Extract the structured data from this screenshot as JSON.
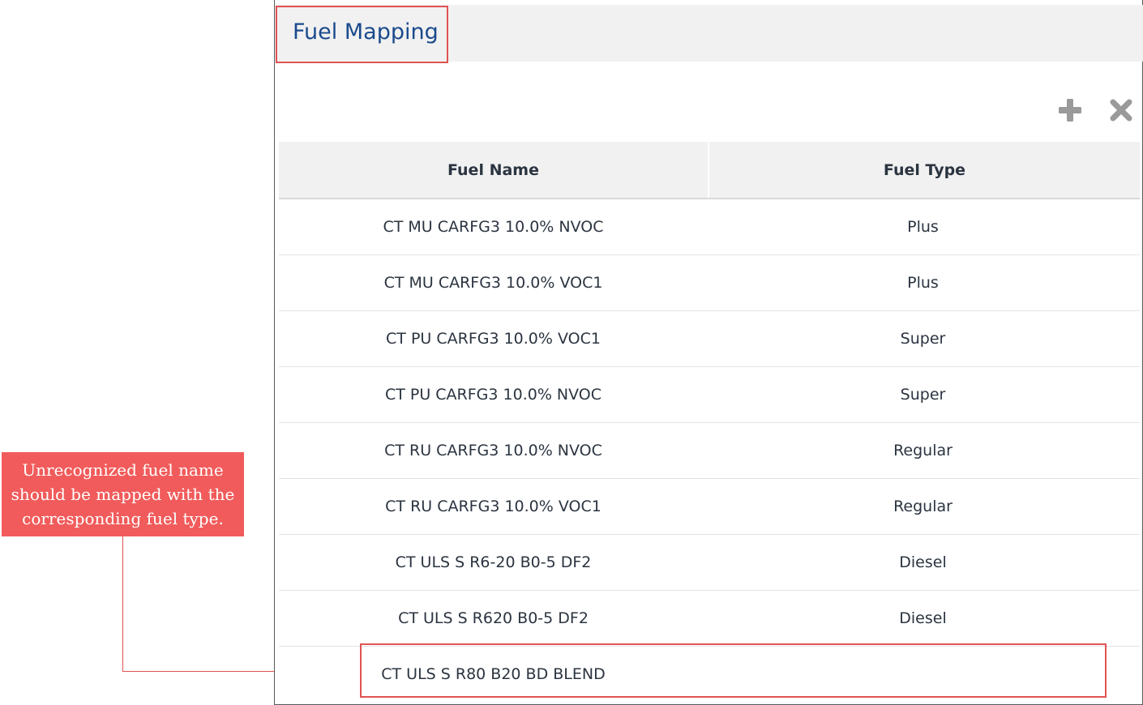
{
  "callout": {
    "lines": [
      "Unrecognized fuel name",
      "should be mapped with the",
      "corresponding fuel type."
    ]
  },
  "panel": {
    "title": "Fuel Mapping",
    "toolbar": {
      "add_icon": "plus-icon",
      "remove_icon": "close-icon"
    }
  },
  "table": {
    "columns": [
      "Fuel Name",
      "Fuel Type"
    ],
    "rows": [
      {
        "name": "CT MU CARFG3 10.0% NVOC",
        "type": "Plus"
      },
      {
        "name": "CT MU CARFG3 10.0% VOC1",
        "type": "Plus"
      },
      {
        "name": "CT PU CARFG3 10.0% VOC1",
        "type": "Super"
      },
      {
        "name": "CT PU CARFG3 10.0% NVOC",
        "type": "Super"
      },
      {
        "name": "CT RU CARFG3 10.0% NVOC",
        "type": "Regular"
      },
      {
        "name": "CT RU CARFG3 10.0% VOC1",
        "type": "Regular"
      },
      {
        "name": "CT ULS S R6-20 B0-5 DF2",
        "type": "Diesel"
      },
      {
        "name": "CT ULS S R620 B0-5 DF2",
        "type": "Diesel"
      },
      {
        "name": "CT ULS S R80 B20 BD BLEND",
        "type": ""
      }
    ]
  },
  "colors": {
    "accent_red": "#f15b5b",
    "title_blue": "#1a4a8c",
    "icon_gray": "#9a9a9a"
  }
}
